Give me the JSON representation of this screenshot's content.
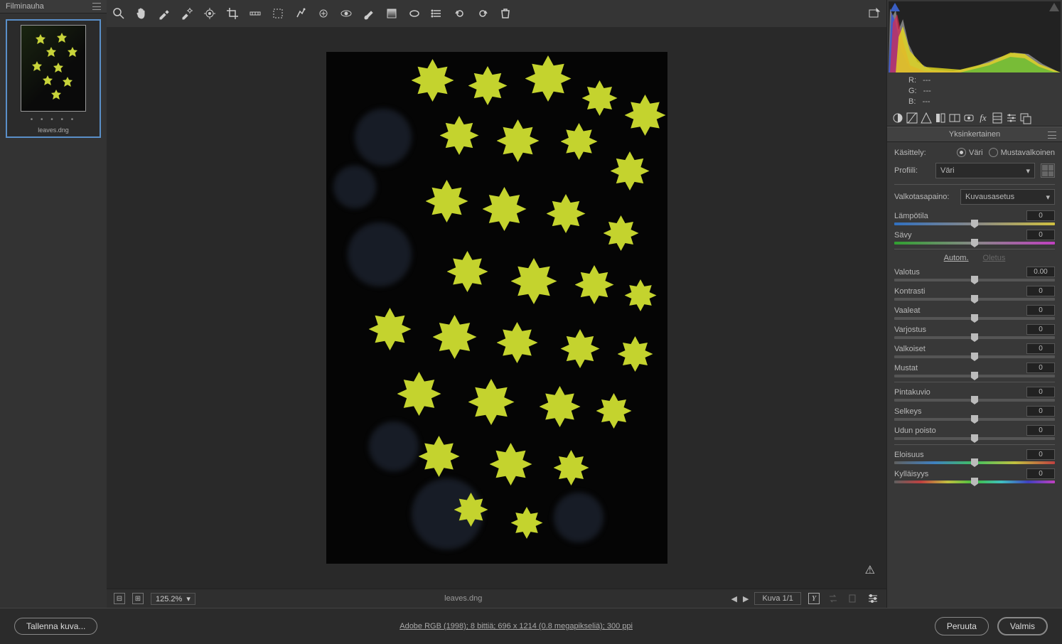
{
  "filmstrip": {
    "title": "Filminauha",
    "thumb_label": "leaves.dng"
  },
  "toolbar": {
    "icons": [
      "zoom",
      "hand",
      "eyedropper",
      "color-sampler",
      "target-adjust",
      "crop",
      "straighten",
      "transform",
      "spot-removal",
      "adjustment-brush",
      "redeye",
      "graduated-filter",
      "radial-filter",
      "rotate-ccw",
      "rotate-cw",
      "preferences",
      "trash"
    ],
    "open_icon": "open-object"
  },
  "status": {
    "zoom": "125.2%",
    "filename": "leaves.dng",
    "image_counter": "Kuva 1/1"
  },
  "histogram_rgb": {
    "r_label": "R:",
    "g_label": "G:",
    "b_label": "B:",
    "r_val": "---",
    "g_val": "---",
    "b_val": "---"
  },
  "panel": {
    "title": "Yksinkertainen",
    "treatment_label": "Käsittely:",
    "treatment_color": "Väri",
    "treatment_bw": "Mustavalkoinen",
    "profile_label": "Profiili:",
    "profile_value": "Väri",
    "wb_label": "Valkotasapaino:",
    "wb_value": "Kuvausasetus",
    "auto": "Autom.",
    "default": "Oletus",
    "sliders": {
      "temp": {
        "label": "Lämpötila",
        "value": "0"
      },
      "tint": {
        "label": "Sävy",
        "value": "0"
      },
      "exposure": {
        "label": "Valotus",
        "value": "0.00"
      },
      "contrast": {
        "label": "Kontrasti",
        "value": "0"
      },
      "highlights": {
        "label": "Vaaleat",
        "value": "0"
      },
      "shadows": {
        "label": "Varjostus",
        "value": "0"
      },
      "whites": {
        "label": "Valkoiset",
        "value": "0"
      },
      "blacks": {
        "label": "Mustat",
        "value": "0"
      },
      "texture": {
        "label": "Pintakuvio",
        "value": "0"
      },
      "clarity": {
        "label": "Selkeys",
        "value": "0"
      },
      "dehaze": {
        "label": "Udun poisto",
        "value": "0"
      },
      "vibrance": {
        "label": "Eloisuus",
        "value": "0"
      },
      "saturation": {
        "label": "Kylläisyys",
        "value": "0"
      }
    }
  },
  "footer": {
    "save": "Tallenna kuva...",
    "info": "Adobe RGB (1998); 8 bittiä; 696 x 1214 (0.8 megapikseliä); 300 ppi",
    "cancel": "Peruuta",
    "done": "Valmis"
  }
}
